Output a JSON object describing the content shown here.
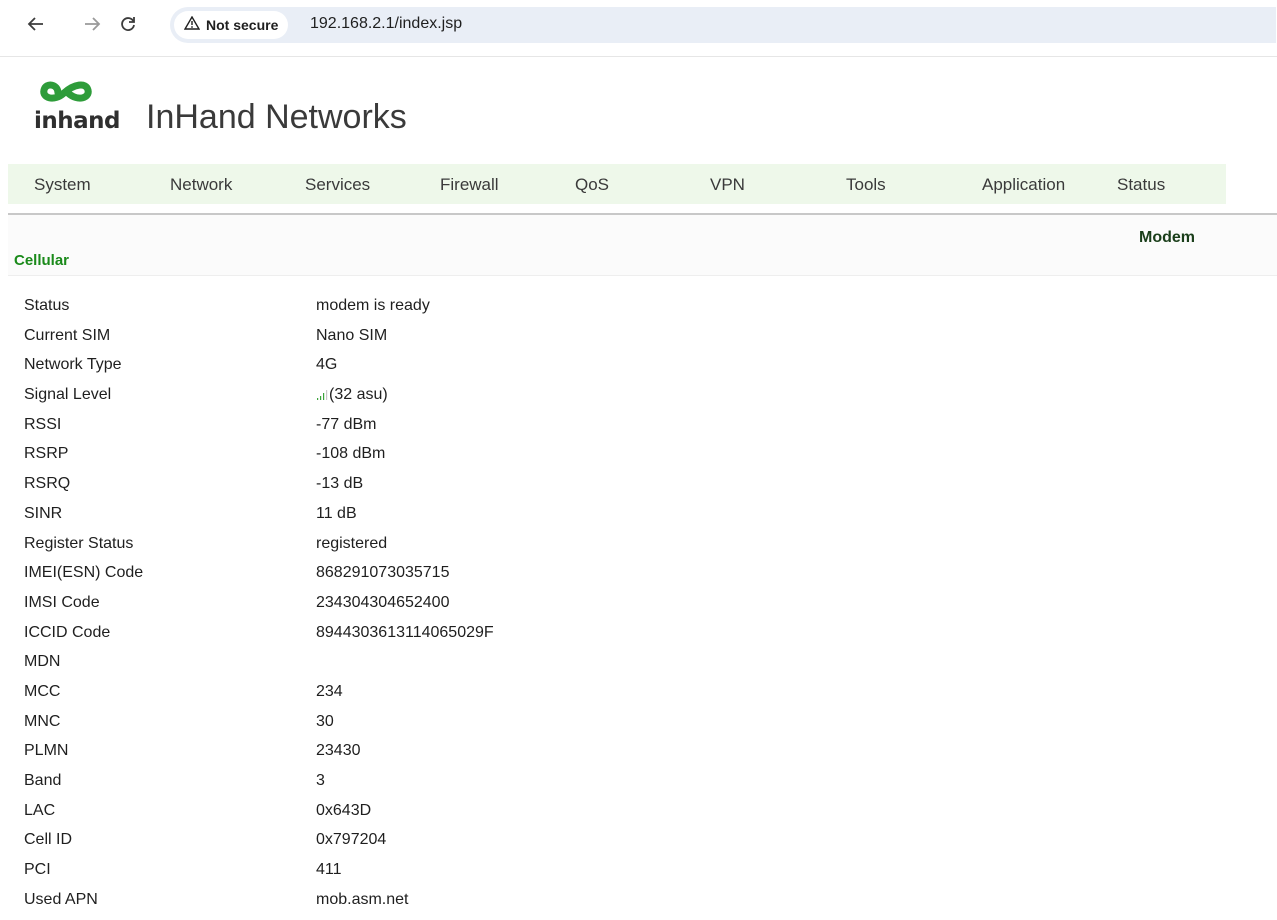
{
  "browser": {
    "security_label": "Not secure",
    "url": "192.168.2.1/index.jsp"
  },
  "header": {
    "logo_text": "inhand",
    "brand_title": "InHand Networks"
  },
  "menu": {
    "items": [
      "System",
      "Network",
      "Services",
      "Firewall",
      "QoS",
      "VPN",
      "Tools",
      "Application",
      "Status"
    ]
  },
  "page": {
    "subtab": "Modem",
    "section_title": "Cellular"
  },
  "details": [
    {
      "label": "Status",
      "value": "modem is ready"
    },
    {
      "label": "Current SIM",
      "value": "Nano SIM"
    },
    {
      "label": "Network Type",
      "value": "4G"
    },
    {
      "label": "Signal Level",
      "value": "(32 asu)"
    },
    {
      "label": "RSSI",
      "value": "-77 dBm"
    },
    {
      "label": "RSRP",
      "value": "-108 dBm"
    },
    {
      "label": "RSRQ",
      "value": "-13 dB"
    },
    {
      "label": "SINR",
      "value": "11 dB"
    },
    {
      "label": "Register Status",
      "value": "registered"
    },
    {
      "label": "IMEI(ESN) Code",
      "value": "868291073035715"
    },
    {
      "label": "IMSI Code",
      "value": "234304304652400"
    },
    {
      "label": "ICCID Code",
      "value": "8944303613114065029F"
    },
    {
      "label": "MDN",
      "value": ""
    },
    {
      "label": "MCC",
      "value": "234"
    },
    {
      "label": "MNC",
      "value": "30"
    },
    {
      "label": "PLMN",
      "value": "23430"
    },
    {
      "label": "Band",
      "value": "3"
    },
    {
      "label": "LAC",
      "value": "0x643D"
    },
    {
      "label": "Cell ID",
      "value": "0x797204"
    },
    {
      "label": "PCI",
      "value": "411"
    },
    {
      "label": "Used APN",
      "value": "mob.asm.net"
    }
  ],
  "colors": {
    "brand_green": "#1a8a1a",
    "menu_bg": "#eef8ea",
    "address_bar_bg": "#e9eef6"
  },
  "icons": {
    "back": "arrow-left-icon",
    "forward": "arrow-right-icon",
    "reload": "reload-icon",
    "security": "warning-triangle-icon",
    "signal": "signal-bars-icon",
    "logo": "inhand-infinity-logo"
  }
}
